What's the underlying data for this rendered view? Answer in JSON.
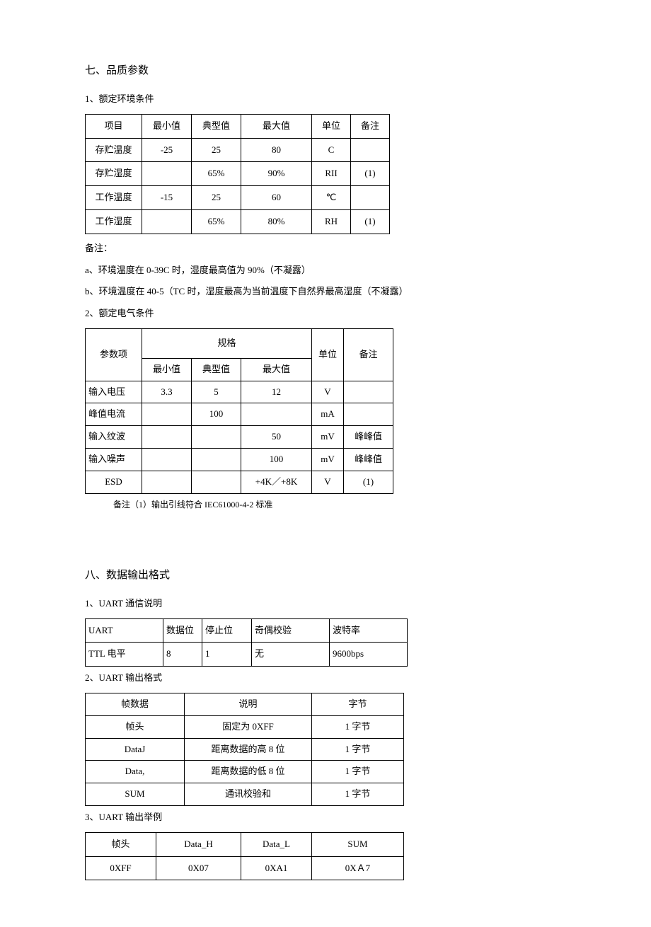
{
  "section7": {
    "title": "七、品质参数",
    "sub1": {
      "title": "1、额定环境条件",
      "headers": [
        "项目",
        "最小值",
        "典型值",
        "最大值",
        "单位",
        "备注"
      ],
      "rows": [
        [
          "存贮温度",
          "-25",
          "25",
          "80",
          "C",
          ""
        ],
        [
          "存贮湿度",
          "",
          "65%",
          "90%",
          "RII",
          "(1)"
        ],
        [
          "工作温度",
          "-15",
          "25",
          "60",
          "℃",
          ""
        ],
        [
          "工作湿度",
          "",
          "65%",
          "80%",
          "RH",
          "(1)"
        ]
      ],
      "notes": [
        "备注：",
        "a、环境温度在 0-39C 时，湿度最高值为 90%（不凝露）",
        "b、环境温度在 40-5（TC 时，湿度最高为当前温度下自然界最高湿度（不凝露）"
      ]
    },
    "sub2": {
      "title": "2、额定电气条件",
      "headerRow1": {
        "param": "参数项",
        "spec": "规格",
        "unit": "单位",
        "remark": "备注"
      },
      "headerRow2": [
        "最小值",
        "典型值",
        "最大值"
      ],
      "rows": [
        [
          "输入电压",
          "3.3",
          "5",
          "12",
          "V",
          ""
        ],
        [
          "峰值电流",
          "",
          "100",
          "",
          "mA",
          ""
        ],
        [
          "输入纹波",
          "",
          "",
          "50",
          "mV",
          "峰峰值"
        ],
        [
          "输入噪声",
          "",
          "",
          "100",
          "mV",
          "峰峰值"
        ],
        [
          "ESD",
          "",
          "",
          "+4K／+8K",
          "V",
          "(1)"
        ]
      ],
      "footnote": "备注（1）输出引线符合 IEC61000-4-2 标准"
    }
  },
  "section8": {
    "title": "八、数据输出格式",
    "sub1": {
      "title": "1、UART 通信说明",
      "headers": [
        "UART",
        "数据位",
        "停止位",
        "奇偶校验",
        "波特率"
      ],
      "rows": [
        [
          "TTL 电平",
          "8",
          "1",
          "无",
          "9600bps"
        ]
      ]
    },
    "sub2": {
      "title": "2、UART 输出格式",
      "headers": [
        "帧数据",
        "说明",
        "字节"
      ],
      "rows": [
        [
          "帧头",
          "固定为 0XFF",
          "1 字节"
        ],
        [
          "DataJ",
          "距离数据的高 8 位",
          "1 字节"
        ],
        [
          "Data,",
          "距离数据的低 8 位",
          "1 字节"
        ],
        [
          "SUM",
          "通讯校验和",
          "1 字节"
        ]
      ]
    },
    "sub3": {
      "title": "3、UART 输出举例",
      "headers": [
        "帧头",
        "Data_H",
        "Data_L",
        "SUM"
      ],
      "rows": [
        [
          "0XFF",
          "0X07",
          "0XA1",
          "0XＡ7"
        ]
      ]
    }
  }
}
